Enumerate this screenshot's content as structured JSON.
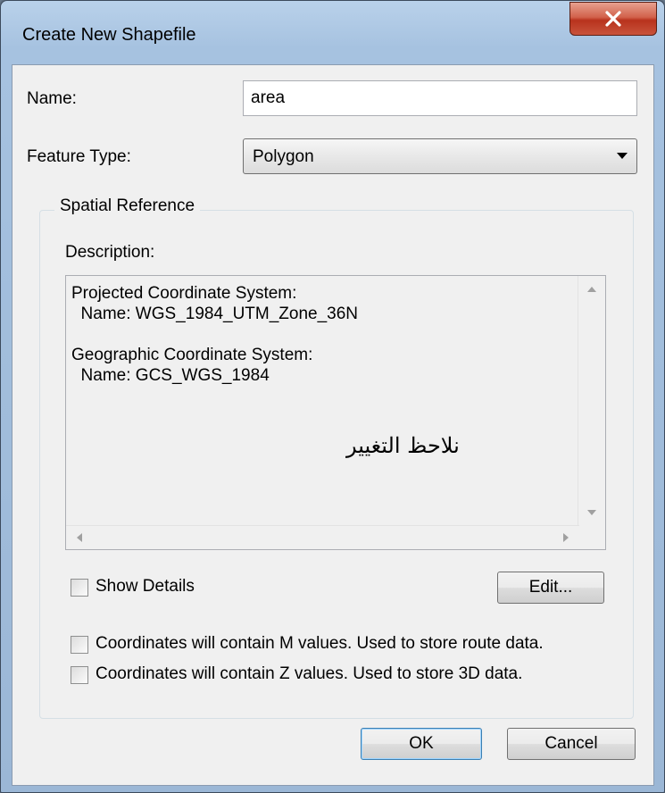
{
  "window": {
    "title": "Create New Shapefile",
    "close_glyph": "X"
  },
  "form": {
    "name_label": "Name:",
    "name_value": "area",
    "feature_type_label": "Feature Type:",
    "feature_type_value": "Polygon"
  },
  "spatial_reference": {
    "group_title": "Spatial Reference",
    "description_label": "Description:",
    "description_text": "Projected Coordinate System:\n  Name: WGS_1984_UTM_Zone_36N\n\nGeographic Coordinate System:\n  Name: GCS_WGS_1984",
    "annotation": "نلاحظ التغيير",
    "show_details_label": "Show Details",
    "show_details_checked": false,
    "edit_button": "Edit..."
  },
  "options": {
    "m_values_label": "Coordinates will contain M values. Used to store route data.",
    "m_values_checked": false,
    "z_values_label": "Coordinates will contain Z values. Used to store 3D data.",
    "z_values_checked": false
  },
  "buttons": {
    "ok": "OK",
    "cancel": "Cancel"
  },
  "icons": {
    "close": "close-icon",
    "dropdown": "chevron-down-icon"
  },
  "colors": {
    "close_button": "#c8533b",
    "default_button_border": "#3c7fb1"
  }
}
